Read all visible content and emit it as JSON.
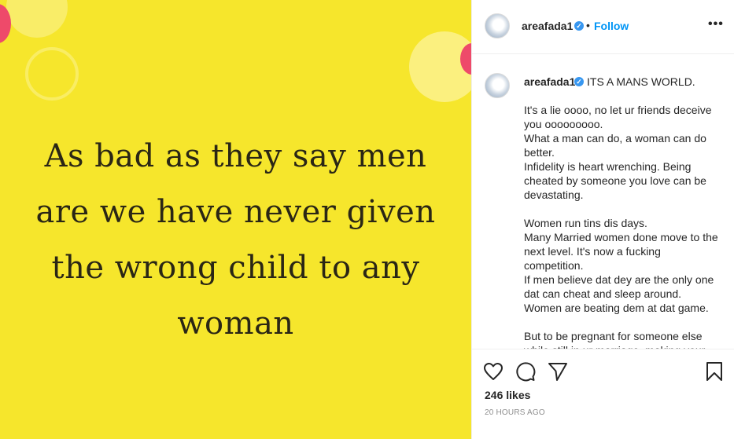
{
  "post_image": {
    "quote": "As bad as they say men\nare we have never given\nthe wrong child to any\nwoman"
  },
  "header": {
    "username": "areafada1",
    "separator": "•",
    "follow_label": "Follow",
    "more_label": "•••"
  },
  "caption": {
    "username": "areafada1",
    "title": "ITS A MANS WORLD.",
    "body": "It's a lie oooo, no let ur friends deceive you ooooooooo.\nWhat a man can do, a woman can do better.\nInfidelity is heart wrenching. Being cheated by someone you love can be devastating.\n\nWomen run tins dis days.\nMany Married women done move to the next level. It's now a fucking competition.\nIf men believe dat dey are the only one dat can cheat and sleep around. Women are beating dem at dat game.\n\nBut to be pregnant for someone else while still in ur marriage, making your"
  },
  "actions": {
    "like_icon": "heart-icon",
    "comment_icon": "comment-icon",
    "share_icon": "paper-plane-icon",
    "save_icon": "bookmark-icon"
  },
  "likes_text": "246 likes",
  "timestamp": "20 HOURS AGO",
  "colors": {
    "image_background": "#f6e62c",
    "accent": "#0095f6",
    "verified_badge": "#3897f0",
    "muted_text": "#8e8e8e"
  }
}
